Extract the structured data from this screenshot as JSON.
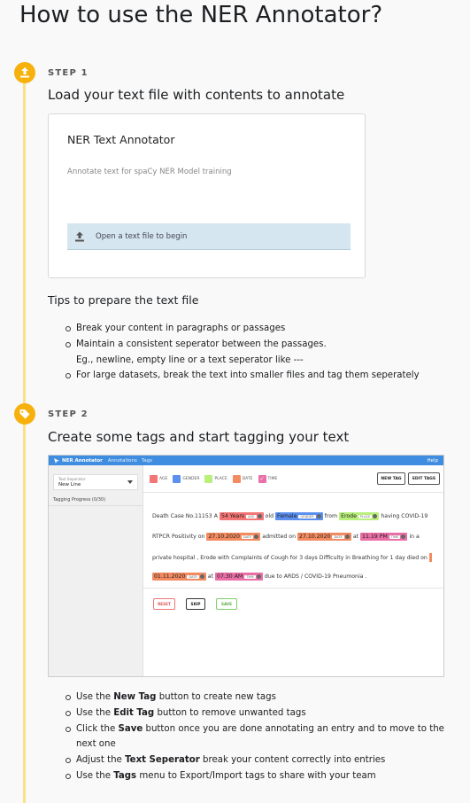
{
  "page_title": "How to use the NER Annotator?",
  "colors": {
    "accent": "#f6b10d",
    "timeline": "#fbe08a",
    "nav": "#3f8de0"
  },
  "step1": {
    "label": "STEP 1",
    "icon": "upload-icon",
    "heading": "Load your text file with contents to annotate",
    "card": {
      "title": "NER Text Annotator",
      "subtitle": "Annotate text for spaCy NER Model training",
      "upload_label": "Open a text file to begin"
    },
    "tips_title": "Tips to prepare the text file",
    "tips": [
      "Break your content in paragraphs or passages",
      "Maintain a consistent seperator between the passages.",
      "Eg., newline, empty line or a text seperator like ---",
      "For large datasets, break the text into smaller files and tag them seperately"
    ]
  },
  "step2": {
    "label": "STEP 2",
    "icon": "tag-icon",
    "heading": "Create some tags and start tagging your text",
    "app": {
      "nav": {
        "brand": "NER Annotator",
        "links": [
          "Annotations",
          "Tags"
        ],
        "help": "Help"
      },
      "separator": {
        "label": "Text Seperator",
        "value": "New Line"
      },
      "progress": "Tagging Progress (0/30)",
      "tags": [
        {
          "name": "AGE",
          "color": "#f37575"
        },
        {
          "name": "GENDER",
          "color": "#5b8ff0"
        },
        {
          "name": "PLACE",
          "color": "#b9ef7b"
        },
        {
          "name": "DATE",
          "color": "#f48b60"
        },
        {
          "name": "TIME",
          "color": "#ea6fa6"
        }
      ],
      "buttons": {
        "new_tag": "NEW TAG",
        "edit_tags": "EDIT TAGS",
        "reset": "RESET",
        "skip": "SKIP",
        "save": "SAVE"
      },
      "text": {
        "l1a": "Death Case No.11153 A",
        "e_age": "54 Years",
        "e_age_lab": "AGE",
        "l1b": "old",
        "e_gender": "Female",
        "e_gender_lab": "GENDER",
        "l1c": "from",
        "e_place": "Erode",
        "e_place_lab": "PLACE",
        "l1d": "having COVID-19",
        "l2a": "RTPCR Positivity on",
        "e_date1": "27.10.2020",
        "e_date1_lab": "DATE",
        "l2b": "admitted on",
        "e_date2": "27.10.2020",
        "e_date2_lab": "DATE",
        "l2c": "at",
        "e_time1": "11.19 PM",
        "e_time1_lab": "TIME",
        "l2d": "in a",
        "l3": "private hospital , Erode with Complaints of Cough for 3 days Difficulty in Breathing for 1 day died on",
        "e_date3": "01.11.2020",
        "e_date3_lab": "DATE",
        "l4a": "at",
        "e_time2": "07.30 AM",
        "e_time2_lab": "TIME",
        "l4b": "due to ARDS / COVID-19 Pneumonia ."
      }
    },
    "tips": {
      "t1_pre": "Use the",
      "t1_b": "New Tag",
      "t1_post": "button to create new tags",
      "t2_pre": "Use the",
      "t2_b": "Edit Tag",
      "t2_post": "button to remove unwanted tags",
      "t3_pre": "Click the",
      "t3_b": "Save",
      "t3_post": "button once you are done annotating an entry and to move to the",
      "t3_cont": "next one",
      "t4_pre": "Adjust the",
      "t4_b": "Text Seperator",
      "t4_post": "break your content correctly into entries",
      "t5_pre": "Use the",
      "t5_b": "Tags",
      "t5_post": "menu to Export/Import tags to share with your team"
    }
  }
}
